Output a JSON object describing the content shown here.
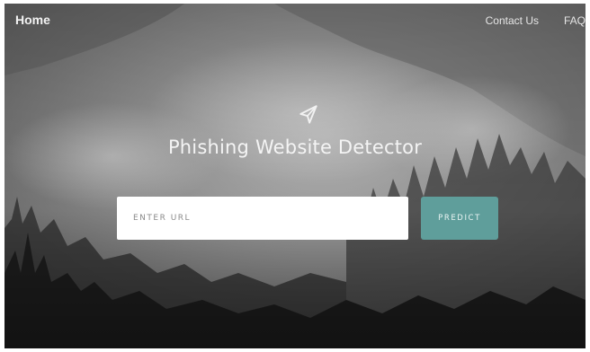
{
  "nav": {
    "home_label": "Home",
    "contact_label": "Contact Us",
    "faq_label": "FAQ"
  },
  "hero": {
    "icon": "paper-plane-icon",
    "title": "Phishing Website Detector"
  },
  "form": {
    "url_placeholder": "ENTER URL",
    "url_value": "",
    "predict_label": "PREDICT"
  },
  "colors": {
    "button_bg": "#5f9e9b",
    "text_light": "#f4f4f4",
    "background_dark": "#3a3a3a"
  }
}
